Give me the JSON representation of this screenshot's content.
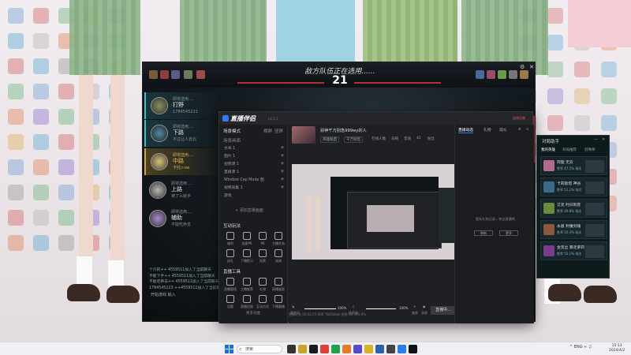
{
  "game": {
    "enemy_picking": "敌方队伍正在选用......",
    "timer": "21",
    "ally_timer": "21",
    "lanes": [
      {
        "sub": "即将选用....",
        "role": "打野",
        "extra": "1784545223"
      },
      {
        "sub": "即将选用....",
        "role": "下路",
        "extra": "不过让人去北"
      },
      {
        "sub": "即将选用....",
        "role": "中路",
        "extra": "卡托>vw"
      },
      {
        "sub": "即将选用....",
        "role": "上路",
        "extra": "被了么就手"
      },
      {
        "sub": "即将选用....",
        "role": "辅助",
        "extra": "不能吃养去"
      }
    ],
    "chat_lines": [
      "个只的++ 4559511加入了当前聊天",
      "不能下手++ 4559511加入了当前聊天",
      "不能吃养去++ 4559511加入了当前聊天",
      "1784545223 ++4559511加入了当前聊天"
    ],
    "chat_input": "开始游戏 输入"
  },
  "app": {
    "title": "直播伴侣",
    "version": "v1.2.3",
    "scenes_head": "场景模式",
    "scenes_tab2": "横屏",
    "scenes_tab3": "竖屏",
    "scene_list_head": "场景画面",
    "scene_items": [
      "文本 1",
      "图片 1",
      "视频源 1",
      "直播源 1",
      "Window Cap Mode 图",
      "视频采集 1",
      "游戏"
    ],
    "add_source": "+ 添加直播画面",
    "interact_title": "互动玩法",
    "interact_tools": [
      "福利",
      "连麦PK",
      "PK",
      "主播任务",
      "送礼",
      "下播提示",
      "投票",
      "连线"
    ],
    "tools_title": "直播工具",
    "tools": [
      "直播管理",
      "主播推荐",
      "礼物",
      "直播画面",
      "话题",
      "直播回放",
      "互动方式",
      "下播重播"
    ],
    "more": "更多功能",
    "room": {
      "title": "别神千万别急999wy的人",
      "tags": [
        "英雄联盟",
        "千万别急"
      ],
      "stats": [
        "在线人数",
        "日榜",
        "音浪",
        "42",
        "粉丝"
      ]
    },
    "controls": {
      "mic_label": "麦克风",
      "mic_value": "100%",
      "speaker_label": "扬声器",
      "speaker_value": "100%",
      "beauty": "美颜",
      "record": "录屏",
      "go_live": "直播中..."
    },
    "status": "直播时长 00:02:25  码率 7845kbps  帧率 60  CPU 6%",
    "right_tabs": [
      "直播动态",
      "礼物",
      "观众"
    ],
    "top_buttons": [
      "连接设备",
      "设置",
      "关闭"
    ],
    "no_gift": "暂无礼物记录，快去直播吧",
    "right_buttons": [
      "刷新",
      "更多"
    ]
  },
  "assist": {
    "title": "对局助手",
    "tabs": [
      "我的英雄",
      "对局推荐",
      "召唤师"
    ],
    "cards": [
      {
        "name": "阿狸 无双",
        "stats": "胜率 47.5%  场次"
      },
      {
        "name": "卡莉斯塔 神谷",
        "stats": "胜率 51.2%  场次"
      },
      {
        "name": "艾克 时间刺客",
        "stats": "胜率 49.8%  场次"
      },
      {
        "name": "永恩 封魔剑魂",
        "stats": "胜率 50.3%  场次"
      },
      {
        "name": "金克丝 暴走萝莉",
        "stats": "胜率 52.1%  场次"
      }
    ]
  },
  "taskbar": {
    "search": "搜索",
    "tray": "ENG",
    "time": "15:13",
    "date": "2024/4/2"
  },
  "colors": {
    "accent": "#2f7bf1",
    "lane_active": "#3fbfd0",
    "lane_mine": "#d6a63a",
    "timer_bar": "#b4322e"
  }
}
